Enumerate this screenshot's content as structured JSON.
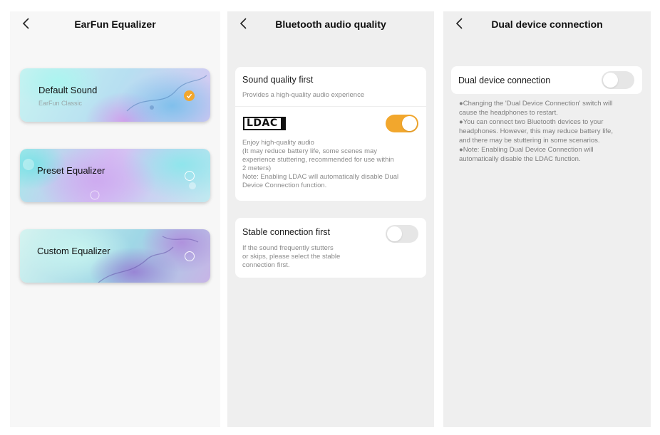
{
  "screen1": {
    "title": "EarFun Equalizer",
    "cards": [
      {
        "name": "Default Sound",
        "subtitle": "EarFun Classic",
        "selected": true
      },
      {
        "name": "Preset Equalizer",
        "selected": false
      },
      {
        "name": "Custom Equalizer",
        "selected": false
      }
    ]
  },
  "screen2": {
    "title": "Bluetooth audio quality",
    "sound_quality": {
      "title": "Sound quality first",
      "subtitle": "Provides a high-quality audio experience",
      "ldac_logo": "LDAC",
      "ldac_enabled": true,
      "desc_lines": [
        "Enjoy high-quality audio",
        "(It may reduce battery life, some scenes may",
        "experience stuttering, recommended for use within",
        "2 meters)",
        "Note: Enabling LDAC will automatically disable Dual",
        "Device Connection function."
      ]
    },
    "stable": {
      "title": "Stable connection first",
      "enabled": false,
      "desc_lines": [
        "If the sound frequently stutters",
        "or skips, please select the stable",
        "connection first."
      ]
    }
  },
  "screen3": {
    "title": "Dual device connection",
    "row_label": "Dual device connection",
    "enabled": false,
    "note_lines": [
      "●Changing the 'Dual Device Connection' switch will",
      "cause the headphones to restart.",
      "●You can connect two Bluetooth devices to your",
      "headphones. However, this may reduce battery life,",
      "and there may be stuttering in some scenarios.",
      "●Note: Enabling Dual Device Connection will",
      "automatically disable the LDAC function."
    ]
  },
  "icons": {
    "back": "chevron-left-icon",
    "selected": "checkmark-icon"
  },
  "colors": {
    "accent": "#f2a72d",
    "toggle_off": "#e6e6e6",
    "page_bg": "#efefef"
  }
}
